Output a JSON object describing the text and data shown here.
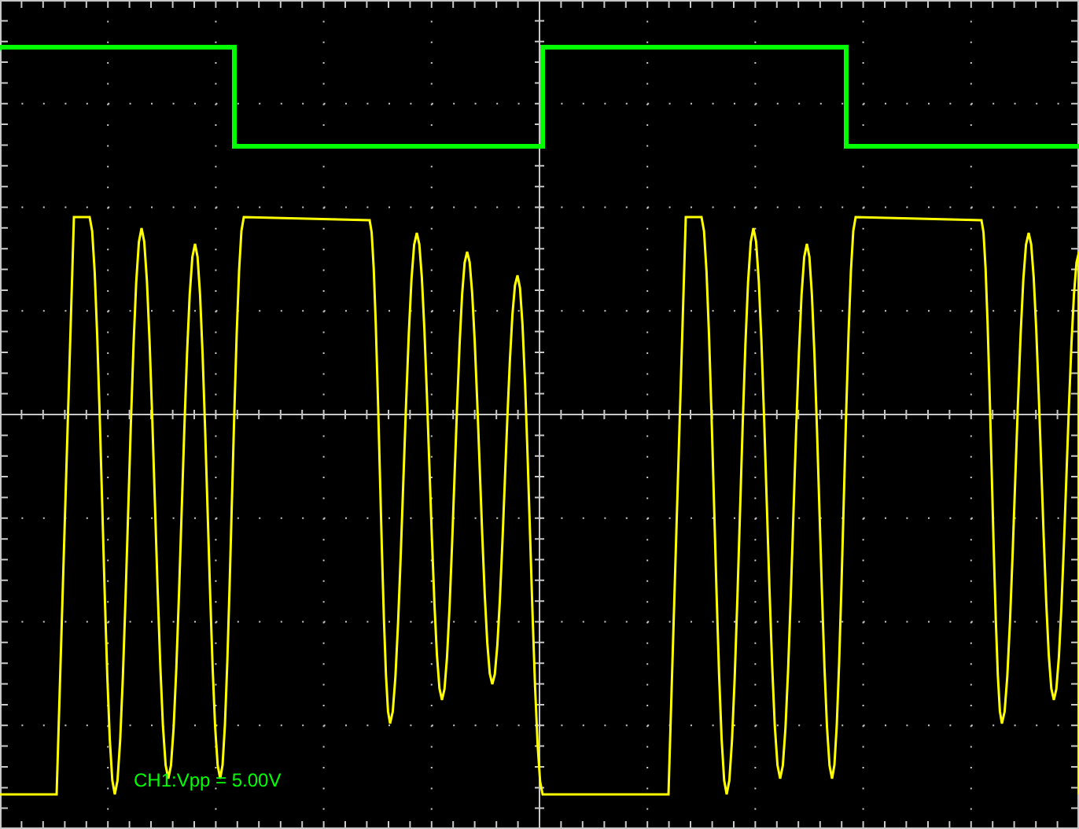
{
  "screen": {
    "traces": [
      {
        "kind": "square",
        "color": "#00ff00"
      },
      {
        "kind": "burst",
        "color": "#ffff00"
      }
    ],
    "measurement": {
      "text": "CH1:Vpp = 5.00V",
      "color": "#00ff00"
    }
  }
}
